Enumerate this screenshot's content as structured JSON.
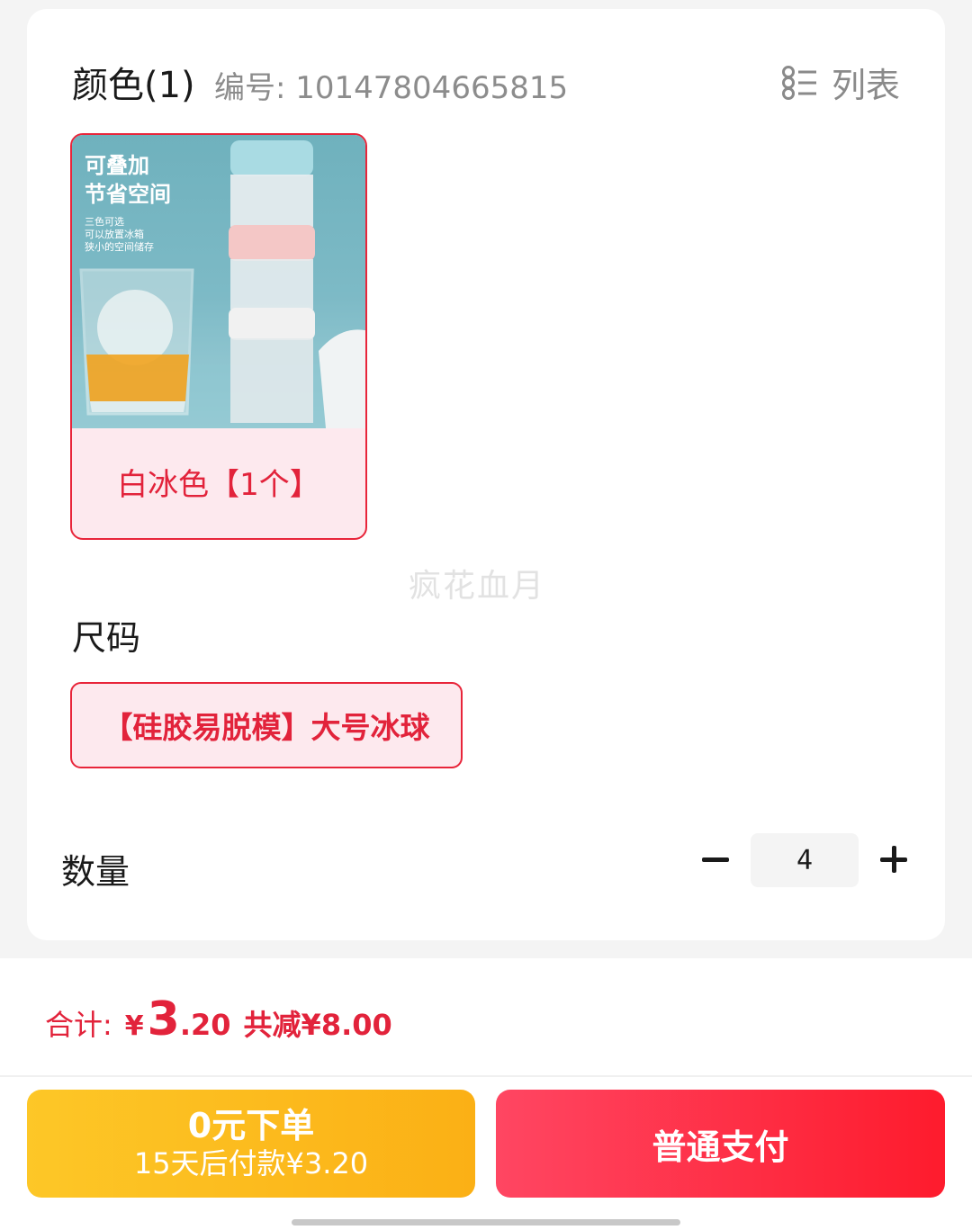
{
  "color_section": {
    "title": "颜色(1)",
    "sku_number": "编号: 10147804665815",
    "list_label": "列表",
    "option": {
      "label": "白冰色【1个】",
      "image_text_line1": "可叠加",
      "image_text_line2": "节省空间",
      "image_caption_1": "三色可选",
      "image_caption_2": "可以放置冰箱",
      "image_caption_3": "狭小的空间储存"
    }
  },
  "watermark": "疯花血月",
  "size_section": {
    "title": "尺码",
    "option_label": "【硅胶易脱模】大号冰球"
  },
  "quantity_section": {
    "title": "数量",
    "value": "4"
  },
  "summary": {
    "total_label": "合计:",
    "currency": "¥",
    "price_integer": "3",
    "price_decimal": ".20",
    "discount": "共减¥8.00"
  },
  "buttons": {
    "zero_line1": "0元下单",
    "zero_line2": "15天后付款¥3.20",
    "pay": "普通支付"
  },
  "colors": {
    "accent_red": "#e2233b",
    "orange_button": "#fbb015",
    "pay_button": "#fe1b2d"
  }
}
